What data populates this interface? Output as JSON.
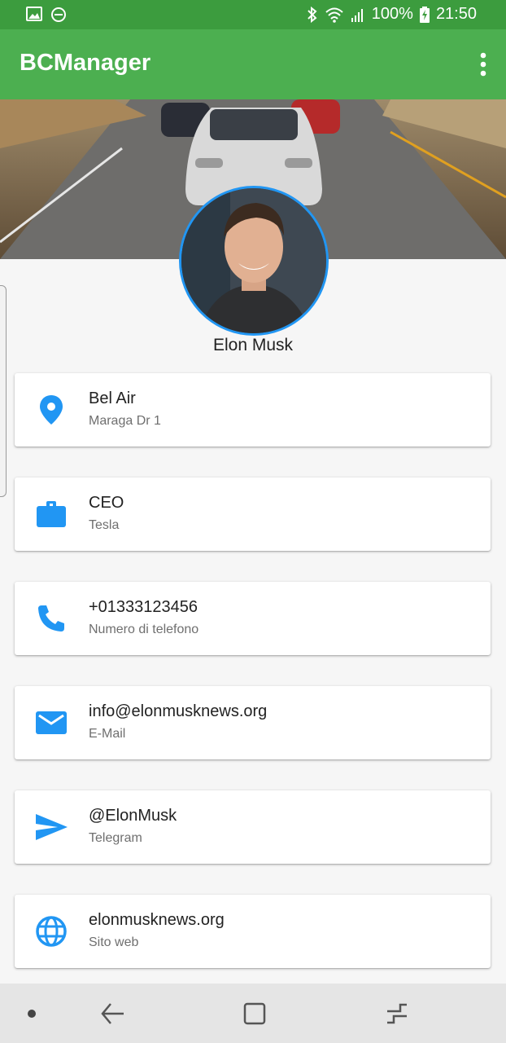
{
  "status_bar": {
    "battery": "100%",
    "time": "21:50",
    "icons": [
      "image-icon",
      "do-not-disturb-icon",
      "bluetooth-icon",
      "wifi-icon",
      "signal-icon",
      "battery-charging-icon"
    ]
  },
  "app_bar": {
    "title": "BCManager",
    "menu_icon": "more-vert-icon"
  },
  "profile": {
    "name": "Elon Musk"
  },
  "contacts": [
    {
      "icon": "location-pin-icon",
      "primary": "Bel Air",
      "secondary": "Maraga Dr 1"
    },
    {
      "icon": "briefcase-icon",
      "primary": "CEO",
      "secondary": "Tesla"
    },
    {
      "icon": "phone-icon",
      "primary": "+01333123456",
      "secondary": "Numero di telefono"
    },
    {
      "icon": "email-icon",
      "primary": "info@elonmusknews.org",
      "secondary": "E-Mail"
    },
    {
      "icon": "send-icon",
      "primary": "@ElonMusk",
      "secondary": "Telegram"
    },
    {
      "icon": "globe-icon",
      "primary": "elonmusknews.org",
      "secondary": "Sito web"
    }
  ],
  "nav_bar": {
    "icons": [
      "dot-icon",
      "back-icon",
      "home-icon",
      "recents-icon"
    ]
  },
  "colors": {
    "app_bar": "#4caf50",
    "status_bar": "#3c9c3e",
    "accent": "#2196f3"
  }
}
